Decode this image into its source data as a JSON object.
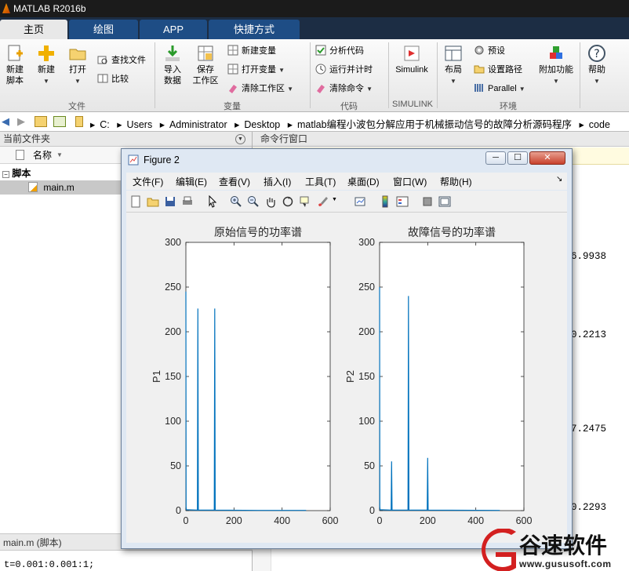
{
  "app": {
    "title": "MATLAB R2016b"
  },
  "ribbon_tabs": [
    {
      "label": "主页",
      "active": true
    },
    {
      "label": "绘图",
      "active": false
    },
    {
      "label": "APP",
      "active": false
    },
    {
      "label": "快捷方式",
      "active": false
    }
  ],
  "ribbon": {
    "new_script": "新建\n脚本",
    "new": "新建",
    "open": "打开",
    "find_files": "查找文件",
    "compare": "比较",
    "import_data": "导入\n数据",
    "save_workspace": "保存\n工作区",
    "new_variable": "新建变量",
    "open_variable": "打开变量",
    "clear_workspace": "清除工作区",
    "analyze_code": "分析代码",
    "run_and_time": "运行并计时",
    "clear_commands": "清除命令",
    "simulink": "Simulink",
    "layout": "布局",
    "preferences": "预设",
    "set_path": "设置路径",
    "parallel": "Parallel",
    "addons": "附加功能",
    "help": "帮助",
    "groups": {
      "file": "文件",
      "variable": "变量",
      "code": "代码",
      "simulink": "SIMULINK",
      "environment": "环境"
    }
  },
  "address": {
    "segments": [
      "C:",
      "Users",
      "Administrator",
      "Desktop",
      "matlab编程小波包分解应用于机械振动信号的故障分析源码程序",
      "code"
    ]
  },
  "left_panel": {
    "title": "当前文件夹",
    "column_name": "名称",
    "folder": "脚本",
    "file": "main.m",
    "details_title": "main.m  (脚本)",
    "code_line": "t=0.001:0.001:1;"
  },
  "command_window": {
    "title": "命令行窗口",
    "values": [
      "6.9938",
      "0.2213",
      "7.2475",
      "0.2293"
    ]
  },
  "figure": {
    "title": "Figure 2",
    "menus": [
      "文件(F)",
      "编辑(E)",
      "查看(V)",
      "插入(I)",
      "工具(T)",
      "桌面(D)",
      "窗口(W)",
      "帮助(H)"
    ]
  },
  "chart_data": [
    {
      "type": "line",
      "title": "原始信号的功率谱",
      "xlabel": "",
      "ylabel": "P1",
      "xlim": [
        0,
        600
      ],
      "ylim": [
        0,
        300
      ],
      "xticks": [
        0,
        200,
        400,
        600
      ],
      "yticks": [
        0,
        50,
        100,
        150,
        200,
        250,
        300
      ],
      "x": [
        0,
        1,
        2,
        48,
        50,
        52,
        118,
        120,
        122,
        300,
        500
      ],
      "y": [
        245,
        4,
        1,
        0.5,
        226,
        0.5,
        0.5,
        226,
        0.5,
        0.3,
        0.3
      ]
    },
    {
      "type": "line",
      "title": "故障信号的功率谱",
      "xlabel": "",
      "ylabel": "P2",
      "xlim": [
        0,
        600
      ],
      "ylim": [
        0,
        300
      ],
      "xticks": [
        0,
        200,
        400,
        600
      ],
      "yticks": [
        0,
        50,
        100,
        150,
        200,
        250,
        300
      ],
      "x": [
        0,
        1,
        2,
        48,
        50,
        52,
        118,
        120,
        122,
        198,
        200,
        202,
        500
      ],
      "y": [
        250,
        4,
        1,
        0.5,
        55,
        0.5,
        0.5,
        240,
        0.5,
        0.5,
        59,
        0.5,
        0.3
      ]
    }
  ],
  "watermark": {
    "brand": "谷速软件",
    "url": "www.gususoft.com"
  }
}
